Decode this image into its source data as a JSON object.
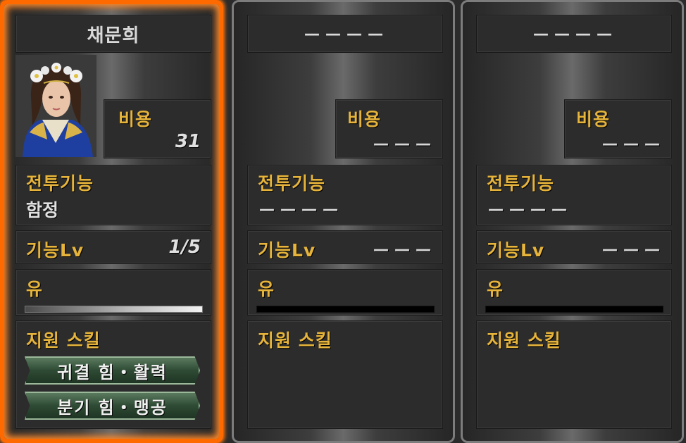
{
  "cards": [
    {
      "name": "채문희",
      "cost_label": "비용",
      "cost_value": "31",
      "skill_label": "전투기능",
      "skill_value": "함정",
      "lv_label": "기능Lv",
      "lv_value": "1/5",
      "type_label": "유",
      "type_gauge": 1.0,
      "support_label": "지원 스킬",
      "support_skills": [
        "귀결 힘・활력",
        "분기 힘・맹공"
      ]
    },
    {
      "name": "－－－－",
      "cost_label": "비용",
      "cost_value": "－－－",
      "skill_label": "전투기능",
      "skill_value": "－－－－",
      "lv_label": "기능Lv",
      "lv_value": "－－－",
      "type_label": "유",
      "type_gauge": 0,
      "support_label": "지원 스킬"
    },
    {
      "name": "－－－－",
      "cost_label": "비용",
      "cost_value": "－－－",
      "skill_label": "전투기능",
      "skill_value": "－－－－",
      "lv_label": "기능Lv",
      "lv_value": "－－－",
      "type_label": "유",
      "type_gauge": 0,
      "support_label": "지원 스킬"
    }
  ],
  "colors": {
    "selected_border": "#ff6a00",
    "label": "#e6b43a",
    "skill_button": "#2e4a34"
  },
  "icons": {
    "portrait": "character-portrait"
  }
}
